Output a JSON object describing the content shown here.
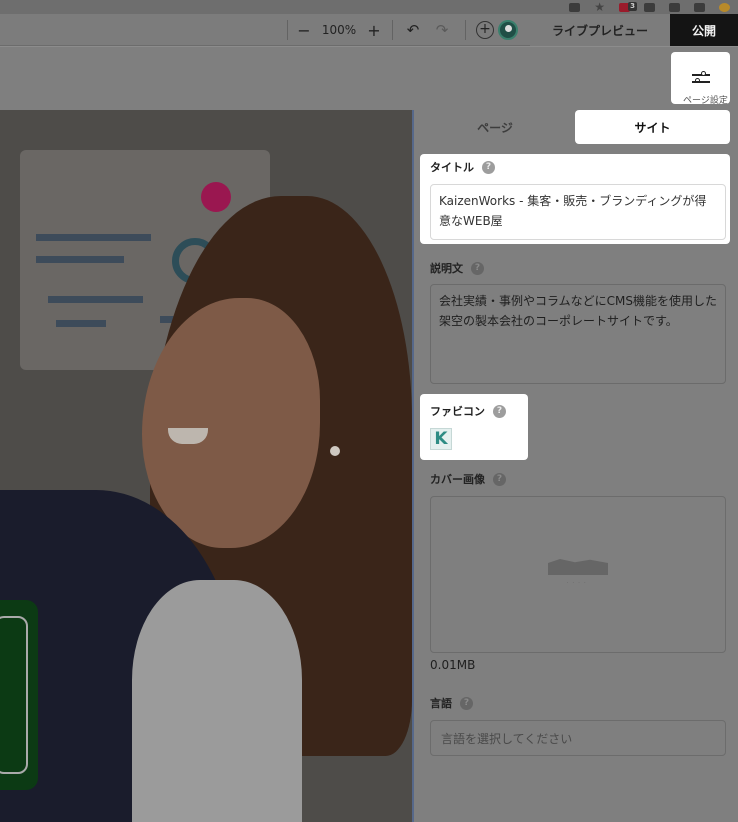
{
  "toolbar": {
    "zoom_minus": "−",
    "zoom_level": "100%",
    "zoom_plus": "+",
    "undo_icon": "↶",
    "redo_icon": "↷",
    "add_icon": "+",
    "live_preview": "ライブプレビュー",
    "publish": "公開",
    "extension_badge": "3"
  },
  "page_settings": {
    "label": "ページ設定"
  },
  "tabs": {
    "page": "ページ",
    "site": "サイト"
  },
  "sections": {
    "title": {
      "label": "タイトル",
      "help": "?",
      "value": "KaizenWorks - 集客・販売・ブランディングが得意なWEB屋"
    },
    "description": {
      "label": "説明文",
      "help": "?",
      "value": "会社実績・事例やコラムなどにCMS機能を使用した架空の製本会社のコーポレートサイトです。"
    },
    "favicon": {
      "label": "ファビコン",
      "help": "?",
      "letter": "K"
    },
    "cover": {
      "label": "カバー画像",
      "help": "?",
      "size": "0.01MB"
    },
    "language": {
      "label": "言語",
      "help": "?",
      "placeholder": "言語を選択してください"
    }
  }
}
